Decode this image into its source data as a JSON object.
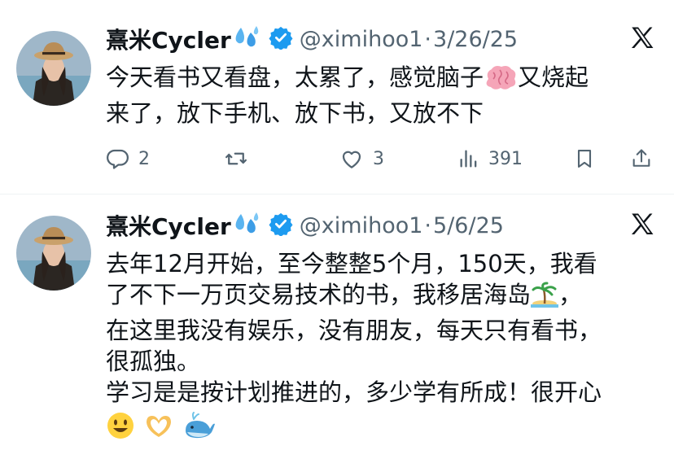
{
  "tweets": [
    {
      "author_name": "熹米Cycler",
      "handle": "@ximihoo1",
      "separator": "·",
      "date": "3/26/25",
      "text_lines": [
        "今天看书又看盘，太累了，感觉脑子",
        "又烧起",
        "来了，放下手机、放下书，又放不下"
      ],
      "replies": "2",
      "likes": "3",
      "views": "391"
    },
    {
      "author_name": "熹米Cycler",
      "handle": "@ximihoo1",
      "separator": "·",
      "date": "5/6/25",
      "text_lines": [
        "去年12月开始，至今整整5个月，150天，我看",
        "了不下一万页交易技术的书，我移居海岛",
        "，",
        "在这里我没有娱乐，没有朋友，每天只有看书，",
        "很孤独。",
        "学习是是按计划推进的，多少学有所成！很开心"
      ]
    }
  ],
  "icons": {
    "verified": "verified-badge-icon",
    "x_logo": "x-logo-icon",
    "reply": "reply-icon",
    "repost": "repost-icon",
    "like": "like-icon",
    "views": "views-icon",
    "bookmark": "bookmark-icon",
    "share": "share-icon",
    "brain": "brain-emoji",
    "island": "island-emoji",
    "smile": "smile-emoji",
    "heart_hands": "heart-hands-emoji",
    "whale": "whale-emoji",
    "sweat": "sweat-drops-emoji"
  },
  "colors": {
    "verified_blue": "#1d9bf0",
    "muted_text": "#536471",
    "text": "#0f1419",
    "divider": "#eff3f4"
  }
}
